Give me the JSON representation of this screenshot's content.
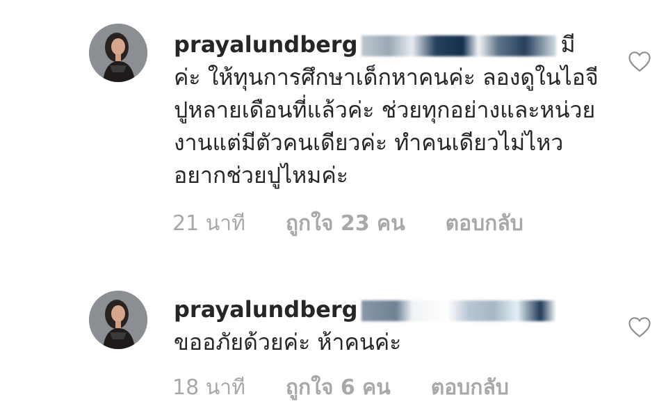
{
  "comments": [
    {
      "username": "prayalundberg",
      "text_after_redaction": "มี",
      "text": "ค่ะ ให้ทุนการศึกษาเด็กหาคนค่ะ ลองดูในไอจีปูหลายเดือนที่แล้วค่ะ ช่วยทุกอย่างและหน่วยงานแต่มีตัวคนเดียวค่ะ ทำคนเดียวไม่ไหว อยากช่วยปูไหมค่ะ",
      "time": "21 นาที",
      "likes": "ถูกใจ 23 คน",
      "reply": "ตอบกลับ",
      "avatar_icon": "profile-photo",
      "like_icon": "heart-outline-icon"
    },
    {
      "username": "prayalundberg",
      "text": "ขออภัยด้วยค่ะ ห้าคนค่ะ",
      "time": "18 นาที",
      "likes": "ถูกใจ 6 คน",
      "reply": "ตอบกลับ",
      "avatar_icon": "profile-photo",
      "like_icon": "heart-outline-icon"
    }
  ],
  "colors": {
    "text": "#262626",
    "meta": "#a8a8a8",
    "icon": "#8e8e8e",
    "background": "#ffffff"
  }
}
